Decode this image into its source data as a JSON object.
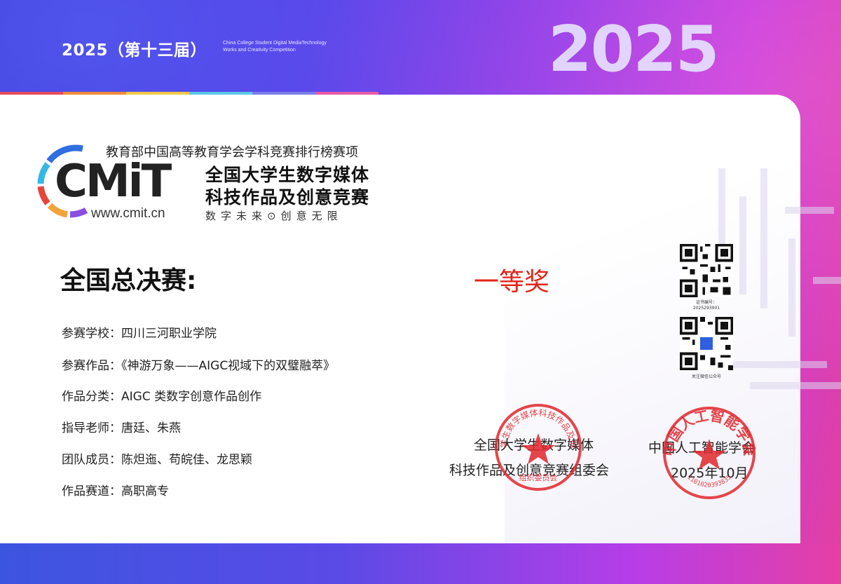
{
  "header": {
    "edition": "2025（第十三届）",
    "english_line1": "China College Student Digital MediaTechnology",
    "english_line2": "Works and Creativity Competition",
    "big_year": "2025"
  },
  "strip_colors": [
    "#e84a5a",
    "#f28b3a",
    "#f7c84a",
    "#5bc6e8",
    "#7b7fe8",
    "#e85aa8"
  ],
  "logo": {
    "wordmark": "CMiT",
    "url": "www.cmit.cn",
    "heading": "教育部中国高等教育学会学科竞赛排行榜赛项",
    "name_line1": "全国大学生数字媒体",
    "name_line2": "科技作品及创意竞赛",
    "slogan": "数字未来⊙创意无限"
  },
  "certificate": {
    "final_title": "全国总决赛:",
    "award": "一等奖",
    "fields": [
      {
        "label": "参赛学校：",
        "value": "四川三河职业学院"
      },
      {
        "label": "参赛作品：",
        "value": "《神游万象——AIGC视域下的双璧融萃》"
      },
      {
        "label": "作品分类：",
        "value": "AIGC 类数字创意作品创作"
      },
      {
        "label": "指导老师：",
        "value": "唐廷、朱燕"
      },
      {
        "label": "团队成员：",
        "value": "陈炟迤、苟皖佳、龙思颖"
      },
      {
        "label": "作品赛道：",
        "value": "高职高专"
      }
    ]
  },
  "qr": {
    "cert_no_label": "证书编号：",
    "cert_no": "2025293901",
    "follow_label": "关注微信公众号"
  },
  "organizers": {
    "org1_line1": "全国大学生数字媒体",
    "org1_line2": "科技作品及创意竞赛组委会",
    "org2_line1": "中国人工智能学会",
    "date": "2025年10月"
  },
  "seals": {
    "seal1_text": "全国大学生数字媒体科技作品及创意竞赛",
    "seal1_bottom": "组织委员会",
    "seal2_text": "中国人工智能学会",
    "seal2_number": "1101020393835"
  },
  "colors": {
    "award_red": "#e2231a",
    "seal_red": "#e0262b"
  }
}
